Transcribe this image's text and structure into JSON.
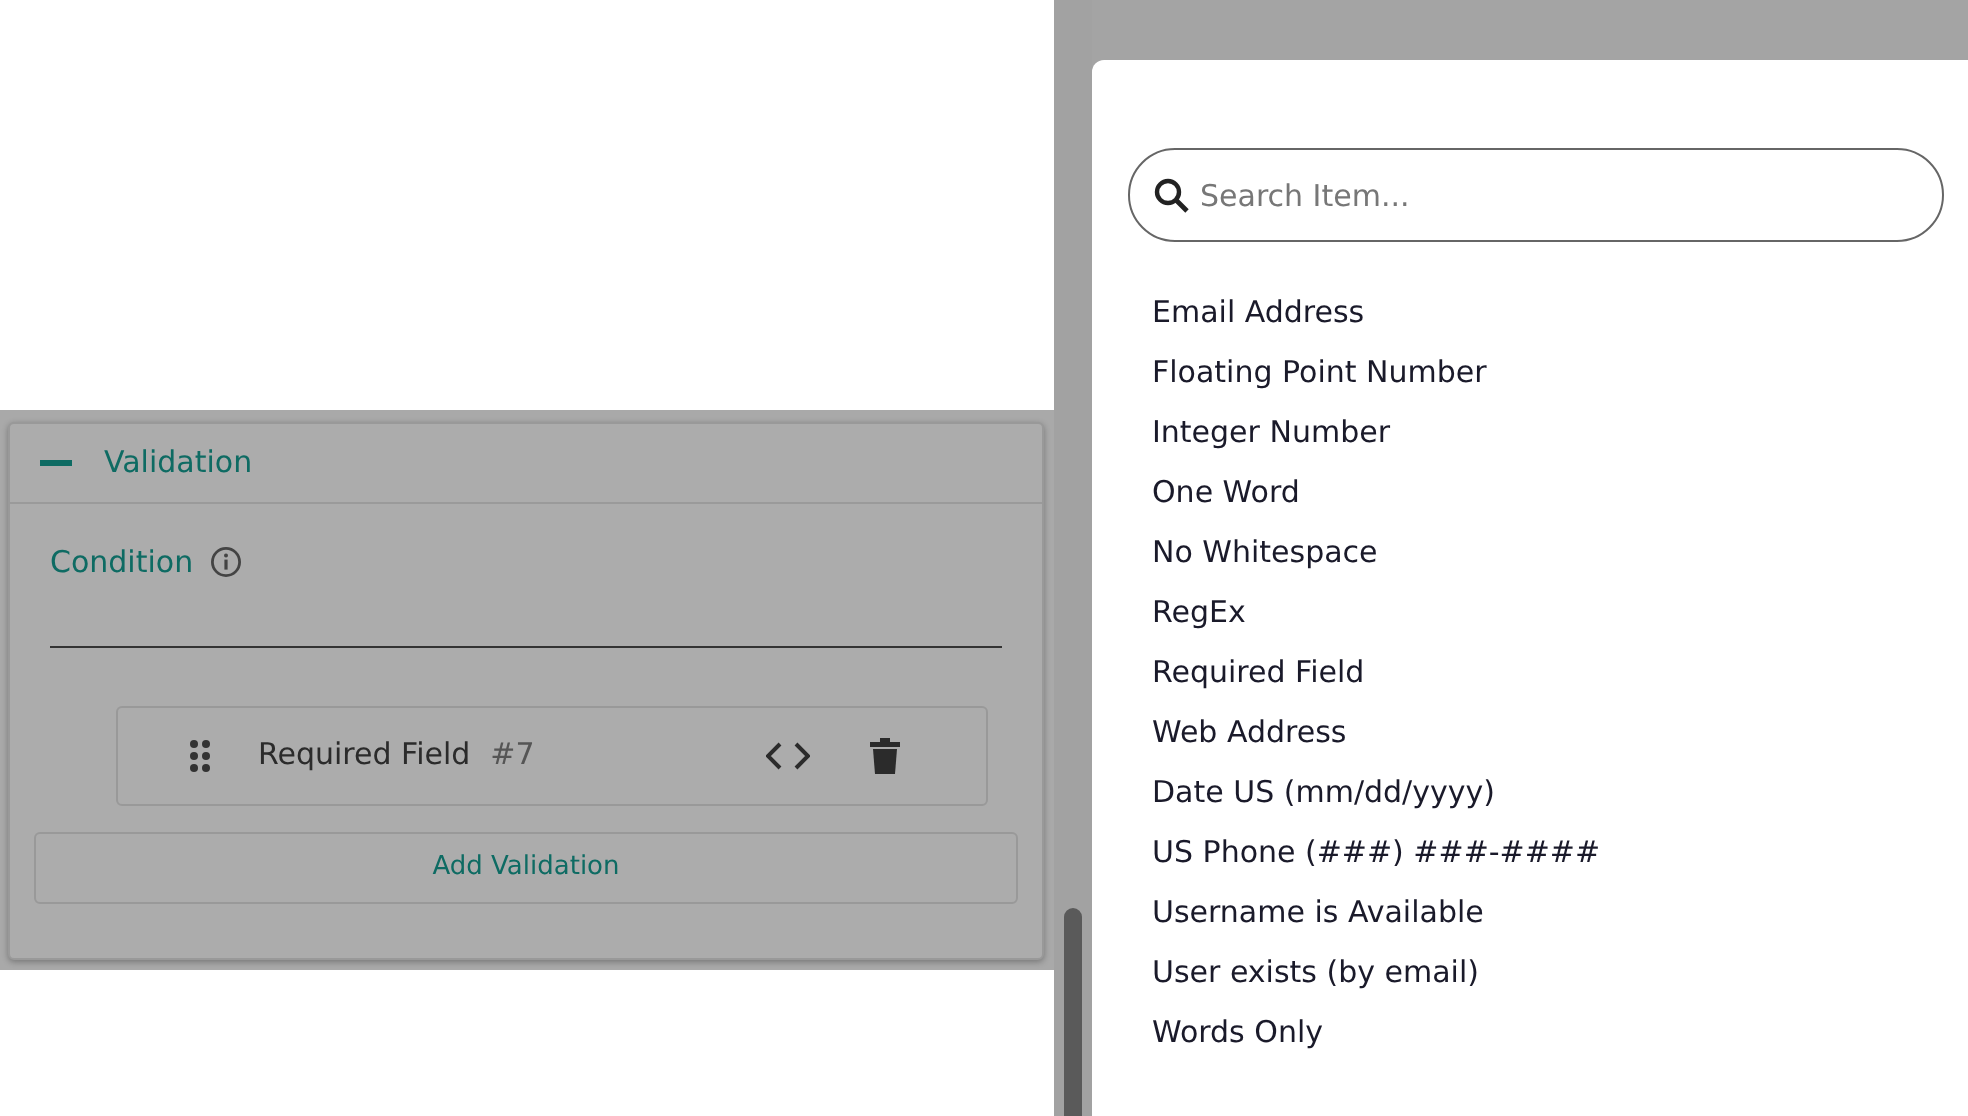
{
  "validation_panel": {
    "title": "Validation",
    "expanded": true,
    "condition_label": "Condition",
    "rules": [
      {
        "name": "Required Field",
        "number": "#7"
      }
    ],
    "add_button": "Add Validation"
  },
  "dropdown": {
    "search": {
      "placeholder": "Search Item..."
    },
    "items": [
      "Email Address",
      "Floating Point Number",
      "Integer Number",
      "One Word",
      "No Whitespace",
      "RegEx",
      "Required Field",
      "Web Address",
      "Date US (mm/dd/yyyy)",
      "US Phone (###) ###-####",
      "Username is Available",
      "User exists (by email)",
      "Words Only"
    ]
  }
}
